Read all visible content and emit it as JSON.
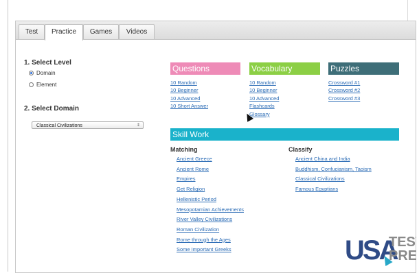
{
  "tabs": [
    "Test",
    "Practice",
    "Games",
    "Videos"
  ],
  "active_tab": "Practice",
  "select_level": {
    "heading": "1. Select Level",
    "options": [
      {
        "label": "Domain",
        "checked": true
      },
      {
        "label": "Element",
        "checked": false
      }
    ]
  },
  "select_domain": {
    "heading": "2. Select Domain",
    "value": "Classical Civilizations"
  },
  "questions": {
    "title": "Questions",
    "color": "#ee8bb7",
    "links": [
      "10 Random",
      "10 Beginner",
      "10 Advanced",
      "10 Short Answer"
    ]
  },
  "vocabulary": {
    "title": "Vocabulary",
    "color": "#8ccf45",
    "links": [
      "10 Random",
      "10 Beginner",
      "10 Advanced",
      "Flashcards",
      "Glossary"
    ]
  },
  "puzzles": {
    "title": "Puzzles",
    "color": "#3e6e78",
    "links": [
      "Crossword #1",
      "Crossword #2",
      "Crossword #3"
    ]
  },
  "skill_work": {
    "title": "Skill Work",
    "color": "#1ab2cb",
    "matching": {
      "label": "Matching",
      "links": [
        "Ancient Greece",
        "Ancient Rome",
        "Empires",
        "Get Religion",
        "Hellenistic Period",
        "Mesopotamian Achievements",
        "River Valley Civilizations",
        "Roman Civilization",
        "Rome through the Ages",
        "Some Important Greeks"
      ]
    },
    "classify": {
      "label": "Classify",
      "links": [
        "Ancient China and India",
        "Buddhism, Confucianism, Taoism",
        "Classical Civilizations",
        "Famous Egyptians"
      ]
    }
  },
  "logo": {
    "usa": "USA",
    "line1": "TEST",
    "line2": "PREP"
  }
}
